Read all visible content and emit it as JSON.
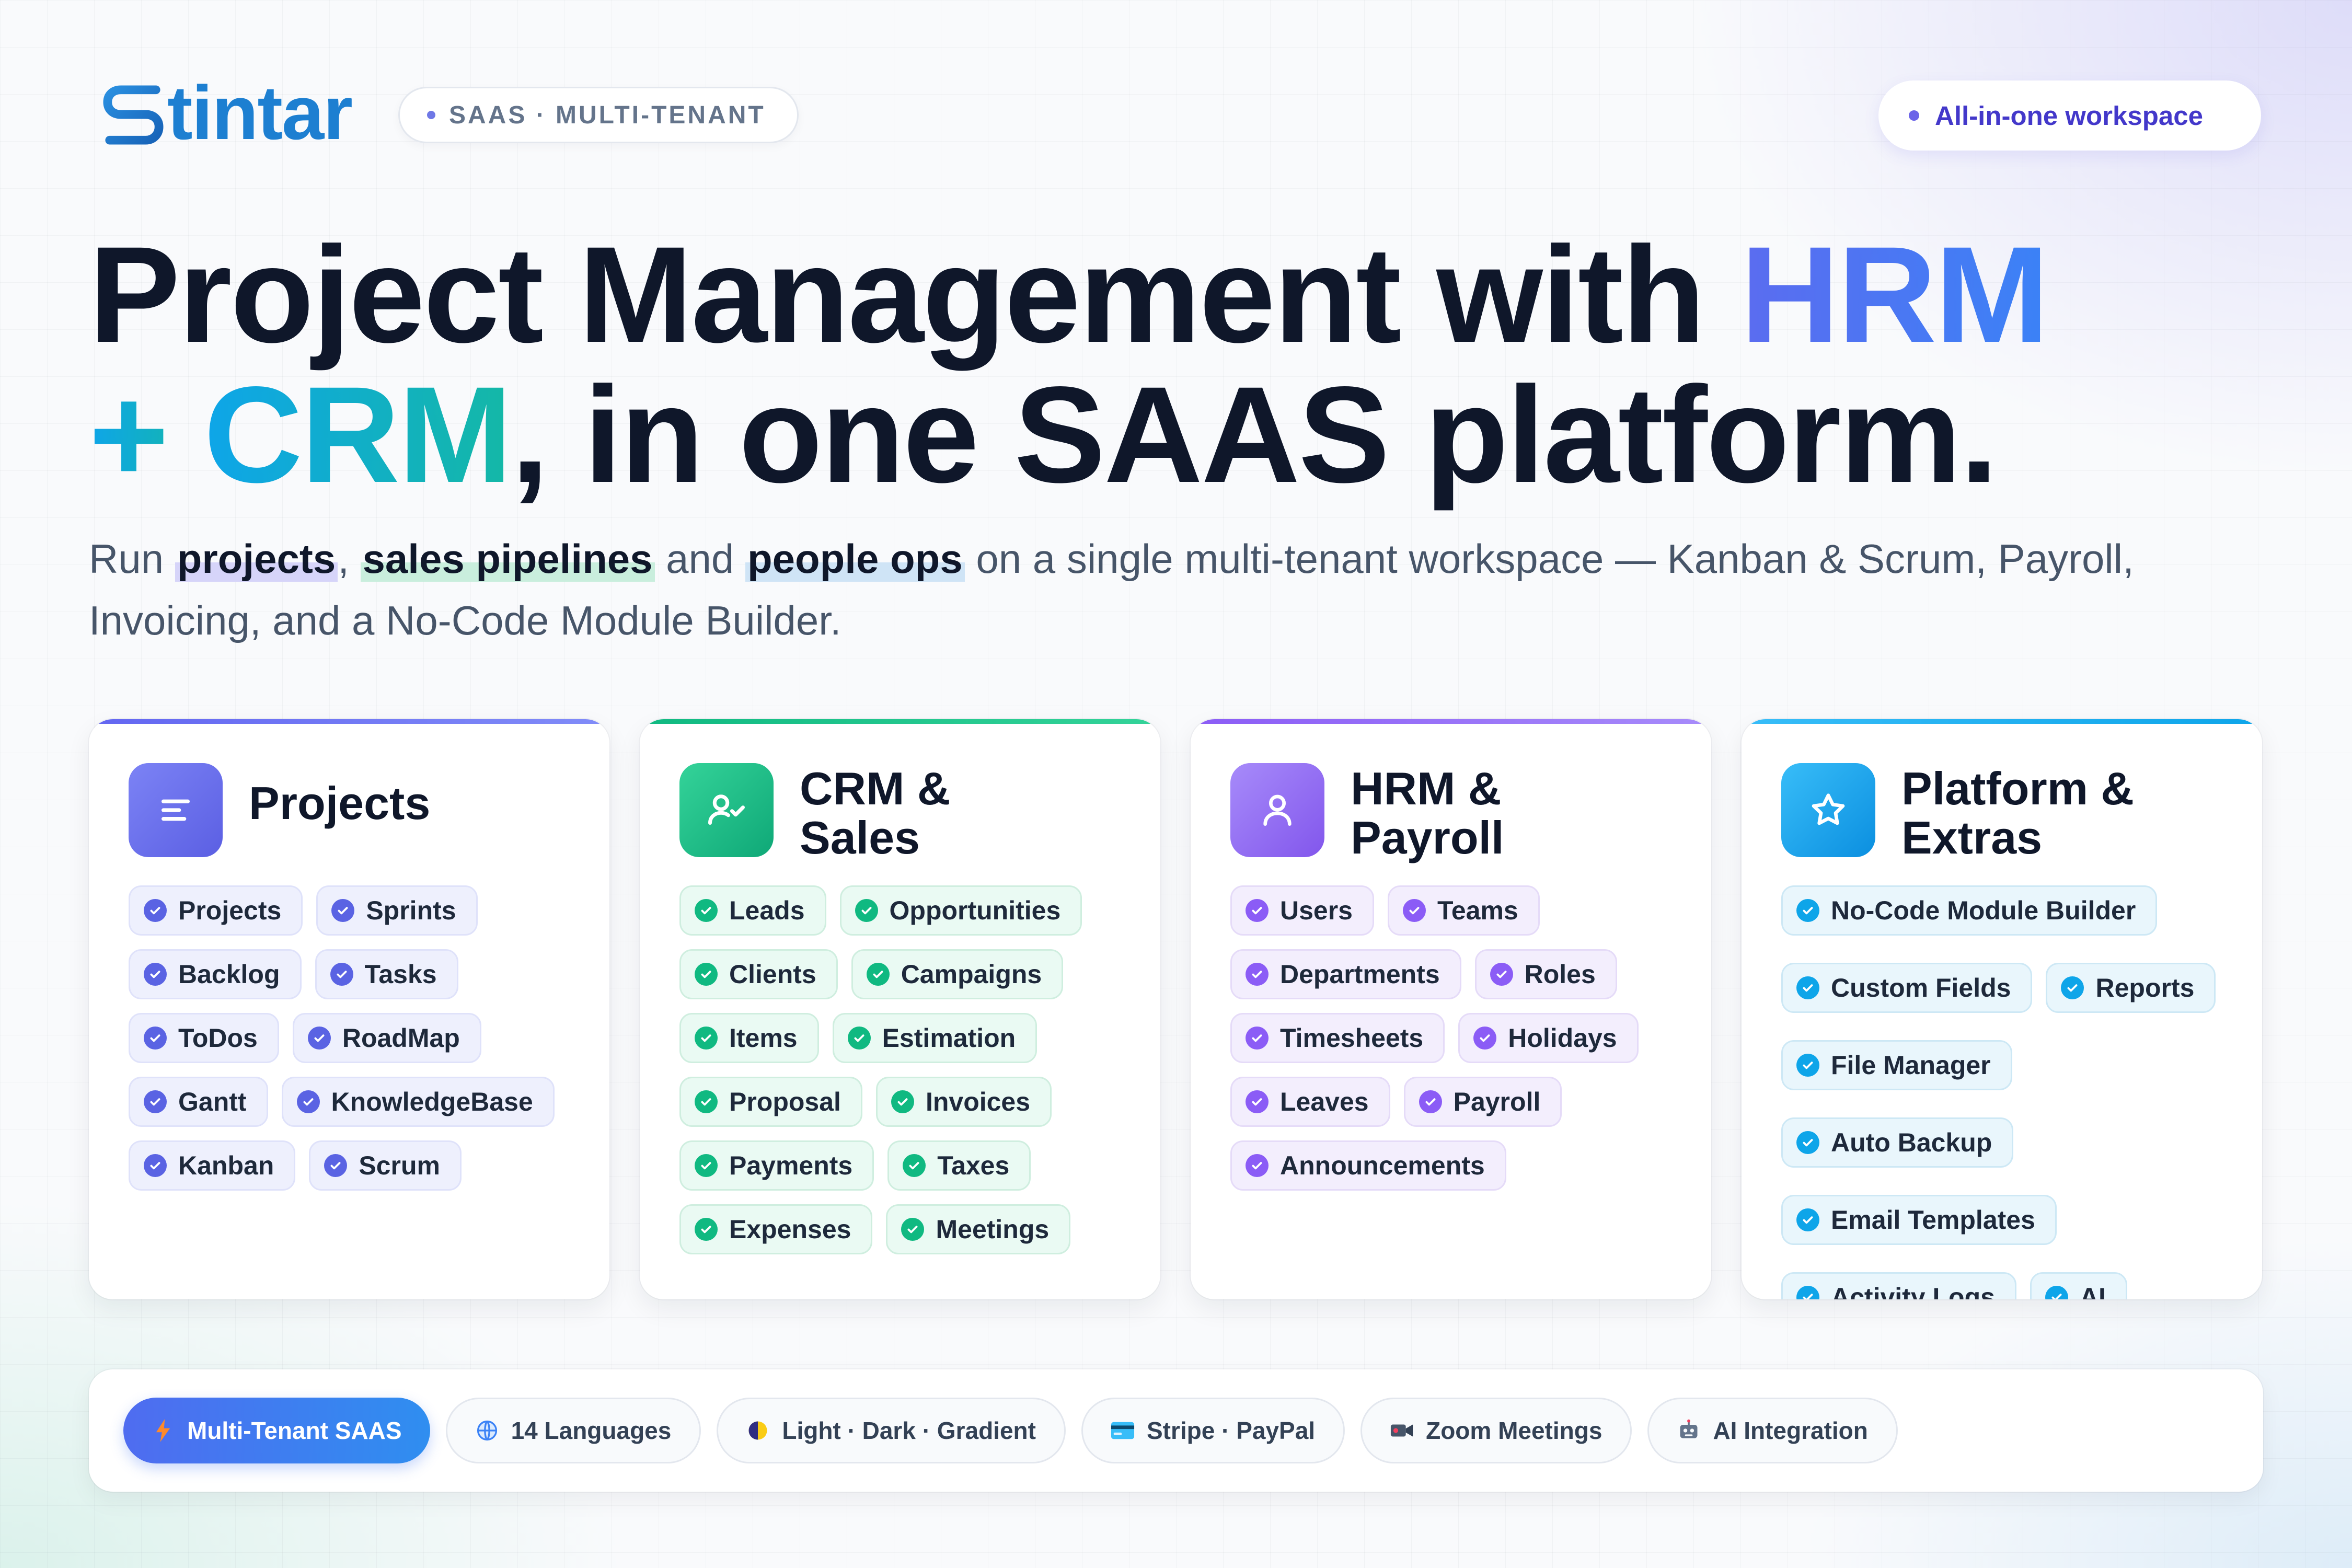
{
  "brand": {
    "name": "tintar",
    "tag": "SAAS · MULTI-TENANT",
    "logo_mark": "s-mark-icon"
  },
  "badge": {
    "label": "All-in-one workspace"
  },
  "headline": {
    "part1": "Project Management with ",
    "hrm": "HRM",
    "part2": "+ ",
    "crm": "CRM",
    "part3": ", in one SAAS platform."
  },
  "subtitle": {
    "run": "Run ",
    "projects": "projects",
    "comma": ", ",
    "sales": "sales pipelines",
    "and": " and ",
    "people": "people ops",
    "rest": " on a single multi-tenant workspace — Kanban & Scrum, Payroll, Invoicing, and a No-Code Module Builder."
  },
  "cards": [
    {
      "title": "Projects",
      "icon": "list-icon",
      "accent": "#6366f1",
      "items": [
        "Projects",
        "Sprints",
        "Backlog",
        "Tasks",
        "ToDos",
        "RoadMap",
        "Gantt",
        "KnowledgeBase",
        "Kanban",
        "Scrum"
      ]
    },
    {
      "title": "CRM & Sales",
      "icon": "user-check-icon",
      "accent": "#10b981",
      "items": [
        "Leads",
        "Opportunities",
        "Clients",
        "Campaigns",
        "Items",
        "Estimation",
        "Proposal",
        "Invoices",
        "Payments",
        "Taxes",
        "Expenses",
        "Meetings"
      ]
    },
    {
      "title": "HRM & Payroll",
      "icon": "user-icon",
      "accent": "#8b5cf6",
      "items": [
        "Users",
        "Teams",
        "Departments",
        "Roles",
        "Timesheets",
        "Holidays",
        "Leaves",
        "Payroll",
        "Announcements"
      ]
    },
    {
      "title": "Platform & Extras",
      "icon": "star-icon",
      "accent": "#0ea5e9",
      "items": [
        "No-Code Module Builder",
        "Custom Fields",
        "Reports",
        "File Manager",
        "Auto Backup",
        "Email Templates",
        "Activity Logs",
        "AI"
      ]
    }
  ],
  "features": [
    {
      "label": "Multi-Tenant SAAS",
      "icon": "lightning-icon"
    },
    {
      "label": "14 Languages",
      "icon": "globe-icon"
    },
    {
      "label": "Light · Dark · Gradient",
      "icon": "half-moon-icon"
    },
    {
      "label": "Stripe · PayPal",
      "icon": "credit-card-icon"
    },
    {
      "label": "Zoom Meetings",
      "icon": "video-camera-icon"
    },
    {
      "label": "AI Integration",
      "icon": "robot-icon"
    }
  ],
  "colors": {
    "brand_blue": "#1d7fd1",
    "headline_hrm": "#5b6cf0",
    "headline_crm": "#14b8a6",
    "projects_accent": "#6366f1",
    "crm_accent": "#10b981",
    "hrm_accent": "#8b5cf6",
    "platform_accent": "#0ea5e9"
  }
}
